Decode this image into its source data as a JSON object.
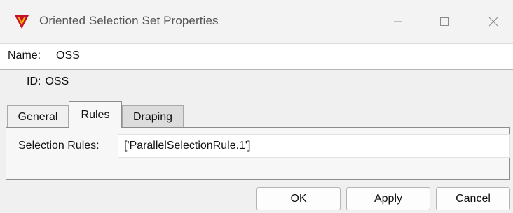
{
  "window": {
    "title": "Oriented Selection Set Properties",
    "icon": "app-logo-icon",
    "controls": {
      "minimize_icon": "minimize-icon",
      "maximize_icon": "maximize-icon",
      "close_icon": "close-icon"
    }
  },
  "form": {
    "name_label": "Name:",
    "name_value": "OSS",
    "id_label": "ID:",
    "id_value": "OSS"
  },
  "tabs": [
    {
      "label": "General",
      "selected": false
    },
    {
      "label": "Rules",
      "selected": true
    },
    {
      "label": "Draping",
      "selected": false
    }
  ],
  "rules_tab": {
    "selection_rules_label": "Selection Rules:",
    "selection_rules_value": "['ParallelSelectionRule.1']"
  },
  "buttons": {
    "ok": "OK",
    "apply": "Apply",
    "cancel": "Cancel"
  },
  "colors": {
    "logo_red": "#c8102e",
    "logo_yellow": "#f5b400",
    "window_bg": "#f0f0f0"
  }
}
